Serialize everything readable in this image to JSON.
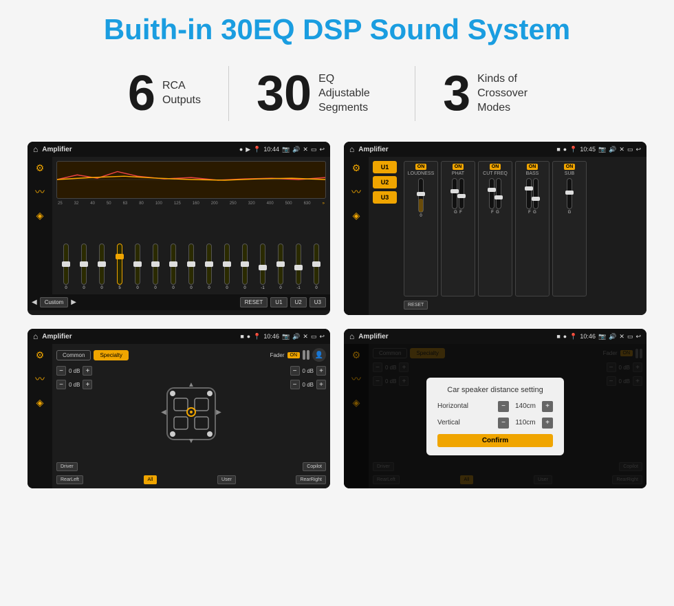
{
  "title": "Buith-in 30EQ DSP Sound System",
  "stats": [
    {
      "number": "6",
      "text": "RCA\nOutputs"
    },
    {
      "number": "30",
      "text": "EQ Adjustable\nSegments"
    },
    {
      "number": "3",
      "text": "Kinds of\nCrossover Modes"
    }
  ],
  "screens": [
    {
      "id": "eq-screen",
      "status_bar": {
        "title": "Amplifier",
        "time": "10:44"
      }
    },
    {
      "id": "crossover-screen",
      "status_bar": {
        "title": "Amplifier",
        "time": "10:45"
      }
    },
    {
      "id": "fader-screen",
      "status_bar": {
        "title": "Amplifier",
        "time": "10:46"
      }
    },
    {
      "id": "dialog-screen",
      "status_bar": {
        "title": "Amplifier",
        "time": "10:46"
      },
      "dialog": {
        "title": "Car speaker distance setting",
        "horizontal_label": "Horizontal",
        "horizontal_value": "140cm",
        "vertical_label": "Vertical",
        "vertical_value": "110cm",
        "confirm_label": "Confirm"
      }
    }
  ],
  "eq": {
    "freq_labels": [
      "25",
      "32",
      "40",
      "50",
      "63",
      "80",
      "100",
      "125",
      "160",
      "200",
      "250",
      "320",
      "400",
      "500",
      "630"
    ],
    "values": [
      0,
      0,
      0,
      5,
      0,
      0,
      0,
      0,
      0,
      0,
      0,
      -1,
      0,
      -1,
      0
    ],
    "bottom_buttons": [
      "Custom",
      "RESET",
      "U1",
      "U2",
      "U3"
    ]
  },
  "crossover": {
    "u_buttons": [
      "U1",
      "U2",
      "U3"
    ],
    "channels": [
      {
        "label": "LOUDNESS",
        "on": true
      },
      {
        "label": "PHAT",
        "on": true
      },
      {
        "label": "CUT FREQ",
        "on": true
      },
      {
        "label": "BASS",
        "on": true
      },
      {
        "label": "SUB",
        "on": true
      }
    ],
    "reset_label": "RESET"
  },
  "fader": {
    "tabs": [
      "Common",
      "Specialty"
    ],
    "fader_label": "Fader",
    "on_label": "ON",
    "bottom_buttons": [
      "Driver",
      "RearLeft",
      "All",
      "User",
      "RearRight",
      "Copilot"
    ]
  },
  "dialog_screen": {
    "tabs": [
      "Common",
      "Specialty"
    ],
    "dialog": {
      "title": "Car speaker distance setting",
      "rows": [
        {
          "label": "Horizontal",
          "value": "140cm"
        },
        {
          "label": "Vertical",
          "value": "110cm"
        }
      ],
      "confirm": "Confirm"
    },
    "bottom_buttons": [
      "Driver",
      "RearLeft",
      "All",
      "User",
      "RearRight",
      "Copilot"
    ]
  }
}
